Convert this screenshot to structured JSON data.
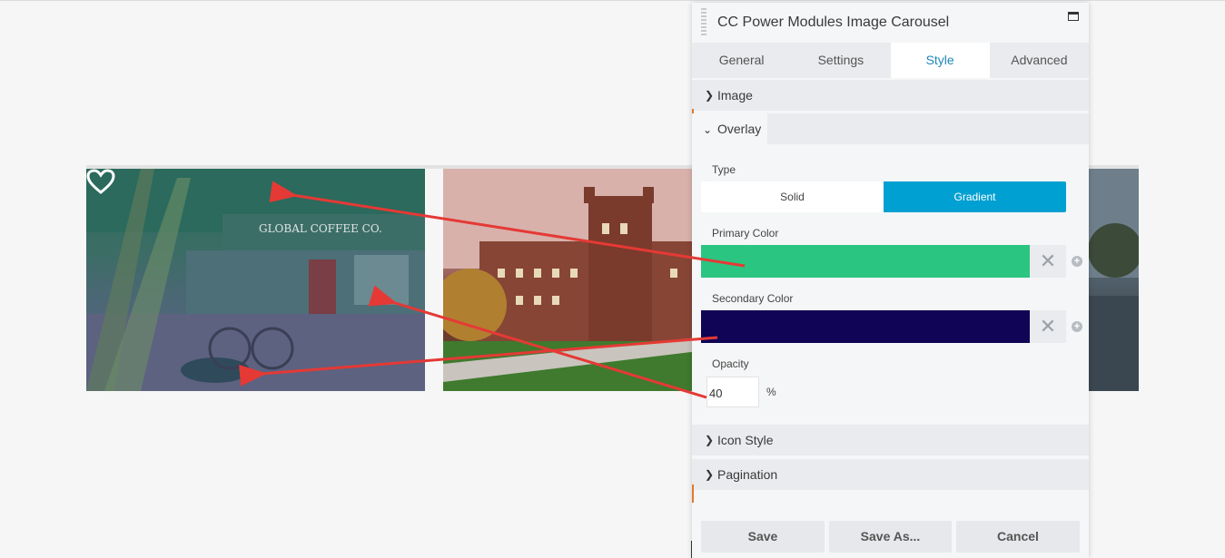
{
  "module_title": "CC Power Modules Image Carousel",
  "tabs": [
    {
      "label": "General"
    },
    {
      "label": "Settings"
    },
    {
      "label": "Style"
    },
    {
      "label": "Advanced"
    }
  ],
  "active_tab": "Style",
  "sections": {
    "image": "Image",
    "overlay": "Overlay",
    "icon_style": "Icon Style",
    "pagination": "Pagination"
  },
  "overlay": {
    "type_label": "Type",
    "type_options": [
      "Solid",
      "Gradient"
    ],
    "type_selected": "Gradient",
    "primary_color_label": "Primary Color",
    "primary_color": "#2bc582",
    "secondary_color_label": "Secondary Color",
    "secondary_color": "#0f0455",
    "opacity_label": "Opacity",
    "opacity_value": "40",
    "opacity_unit": "%"
  },
  "footer": {
    "save": "Save",
    "save_as": "Save As...",
    "cancel": "Cancel"
  },
  "carousel": {
    "storefront_sign": "GLOBAL COFFEE CO."
  },
  "colors": {
    "accent": "#00a0d2",
    "annotation_arrow": "#e53935",
    "active_tab_text": "#1e88b8"
  },
  "icons": [
    "heart-icon",
    "chevron-right-icon",
    "chevron-down-icon",
    "clear-icon",
    "plus-circle-icon",
    "window-icon",
    "drag-handle-icon"
  ]
}
